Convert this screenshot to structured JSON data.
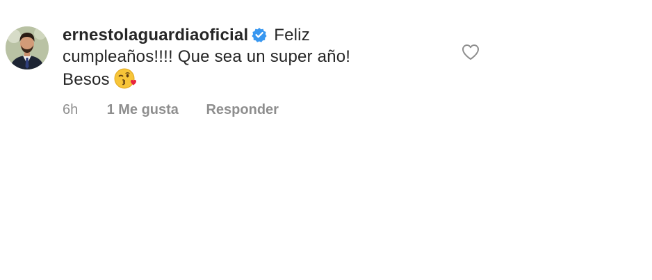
{
  "comment": {
    "username": "ernestolaguardiaoficial",
    "text": "Feliz cumpleaños!!!! Que sea un super año! Besos",
    "emoji": "kissing-face-with-heart",
    "verified": true,
    "timestamp": "6h",
    "likes_label": "1 Me gusta",
    "reply_label": "Responder"
  },
  "colors": {
    "text": "#262626",
    "muted": "#8e8e8e",
    "verified_badge": "#3897f0",
    "heart_outline": "#8e8e8e"
  },
  "icons": {
    "avatar": "profile-photo",
    "verified": "verified-badge-icon",
    "like": "heart-outline-icon"
  }
}
